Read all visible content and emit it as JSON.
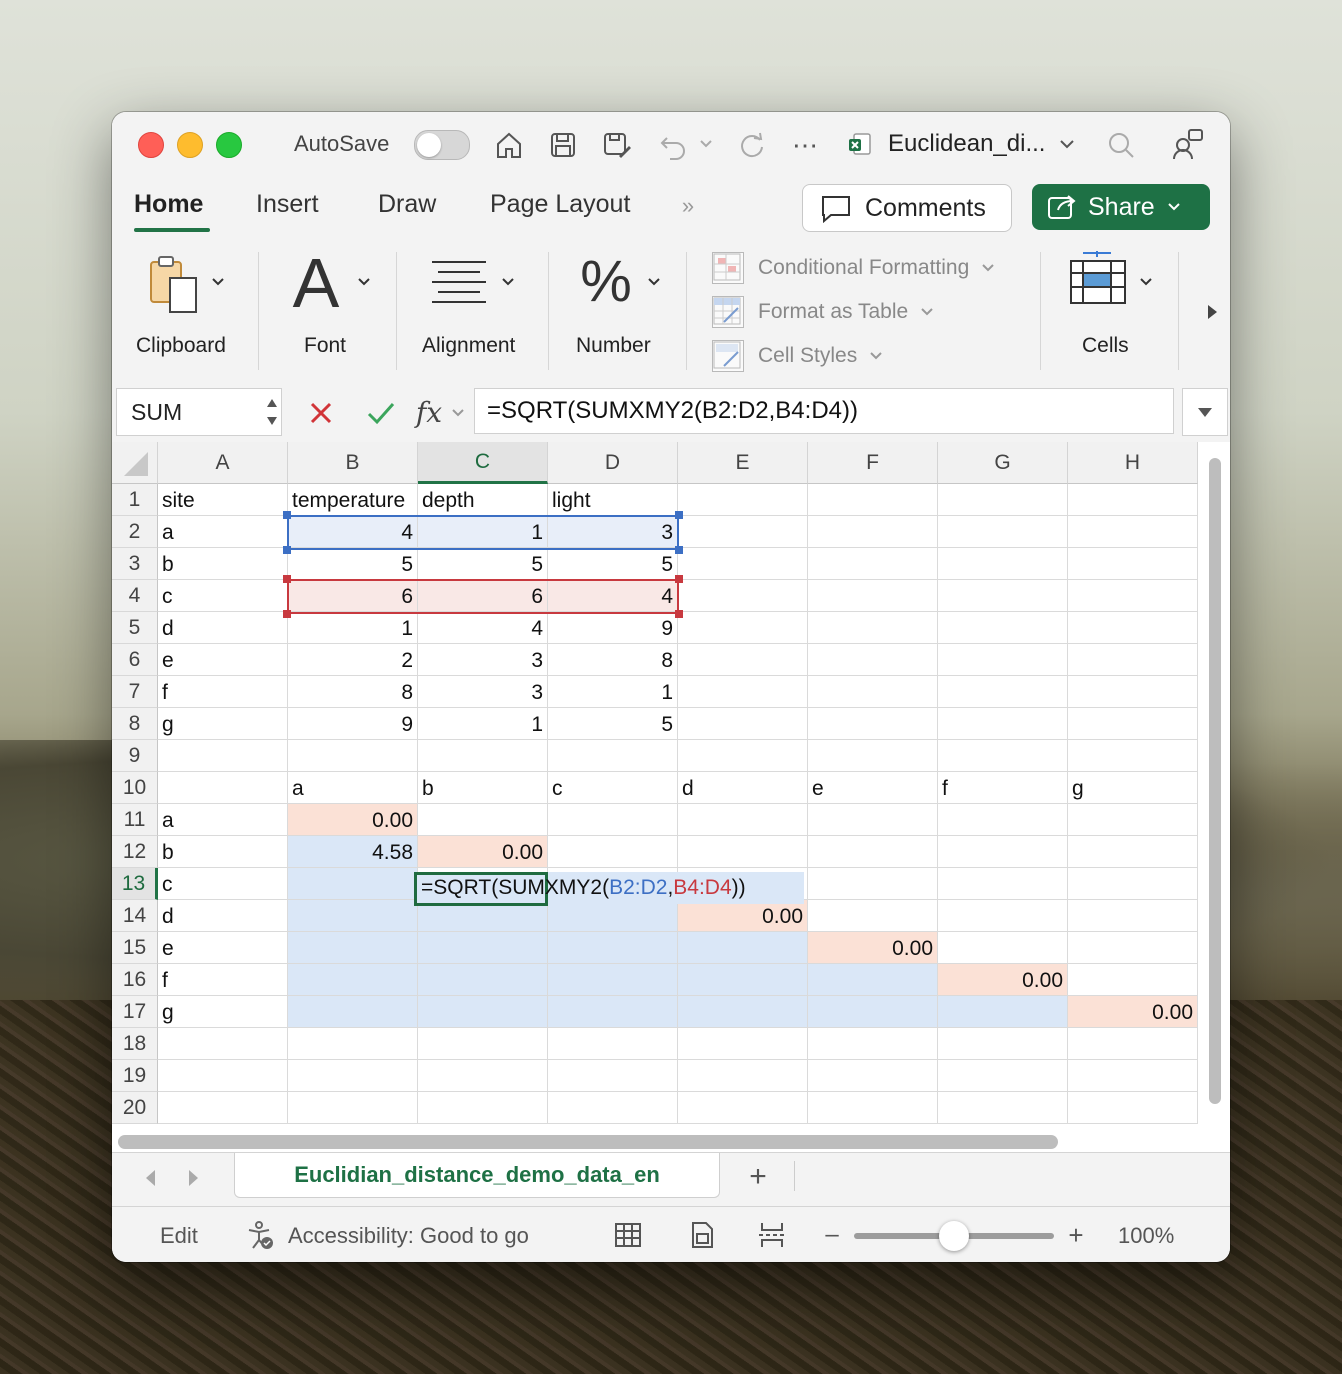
{
  "titlebar": {
    "autosave_label": "AutoSave",
    "document_title": "Euclidean_di...",
    "icons": [
      "home-icon",
      "save-icon",
      "save-as-icon",
      "undo-icon",
      "redo-icon",
      "more-icon",
      "excel-file-icon",
      "search-icon",
      "share-people-icon"
    ]
  },
  "tabs": {
    "items": [
      "Home",
      "Insert",
      "Draw",
      "Page Layout"
    ],
    "active": "Home",
    "comments_label": "Comments",
    "share_label": "Share"
  },
  "ribbon": {
    "clipboard": "Clipboard",
    "font": "Font",
    "alignment": "Alignment",
    "number": "Number",
    "conditional_formatting": "Conditional Formatting",
    "format_as_table": "Format as Table",
    "cell_styles": "Cell Styles",
    "cells": "Cells"
  },
  "formula_bar": {
    "name_box": "SUM",
    "formula": "=SQRT(SUMXMY2(B2:D2,B4:D4))"
  },
  "sheet": {
    "columns": [
      "A",
      "B",
      "C",
      "D",
      "E",
      "F",
      "G",
      "H"
    ],
    "selected_column": "C",
    "rows": [
      "1",
      "2",
      "3",
      "4",
      "5",
      "6",
      "7",
      "8",
      "9",
      "10",
      "11",
      "12",
      "13",
      "14",
      "15",
      "16",
      "17",
      "18",
      "19",
      "20"
    ],
    "selected_row": "13",
    "header_row": [
      "site",
      "temperature",
      "depth",
      "light"
    ],
    "data_rows": [
      [
        "a",
        "4",
        "1",
        "3"
      ],
      [
        "b",
        "5",
        "5",
        "5"
      ],
      [
        "c",
        "6",
        "6",
        "4"
      ],
      [
        "d",
        "1",
        "4",
        "9"
      ],
      [
        "e",
        "2",
        "3",
        "8"
      ],
      [
        "f",
        "8",
        "3",
        "1"
      ],
      [
        "g",
        "9",
        "1",
        "5"
      ]
    ],
    "matrix_col_labels": [
      "a",
      "b",
      "c",
      "d",
      "e",
      "f",
      "g"
    ],
    "matrix_row_labels": [
      "a",
      "b",
      "c",
      "d",
      "e",
      "f",
      "g"
    ],
    "matrix_values": {
      "a_a": "0.00",
      "b_a": "4.58",
      "b_b": "0.00",
      "d_d": "0.00",
      "e_e": "0.00",
      "f_f": "0.00",
      "g_g": "0.00"
    },
    "editing_cell": {
      "prefix": "=SQRT(SUMXMY2(",
      "ref1": "B2:D2",
      "comma": ",",
      "ref2": "B4:D4",
      "suffix": "))",
      "ref1_color": "#3c6fc4",
      "ref2_color": "#c8393f"
    }
  },
  "sheet_tabs": {
    "active": "Euclidian_distance_demo_data_en",
    "add_label": "+"
  },
  "status": {
    "mode": "Edit",
    "accessibility": "Accessibility: Good to go",
    "zoom": "100%",
    "zoom_fraction": 0.5
  },
  "colors": {
    "accent_green": "#217346",
    "share_green": "#1e7145",
    "fill_blue": "#dae7f7",
    "fill_peach": "#fbe1d6"
  }
}
